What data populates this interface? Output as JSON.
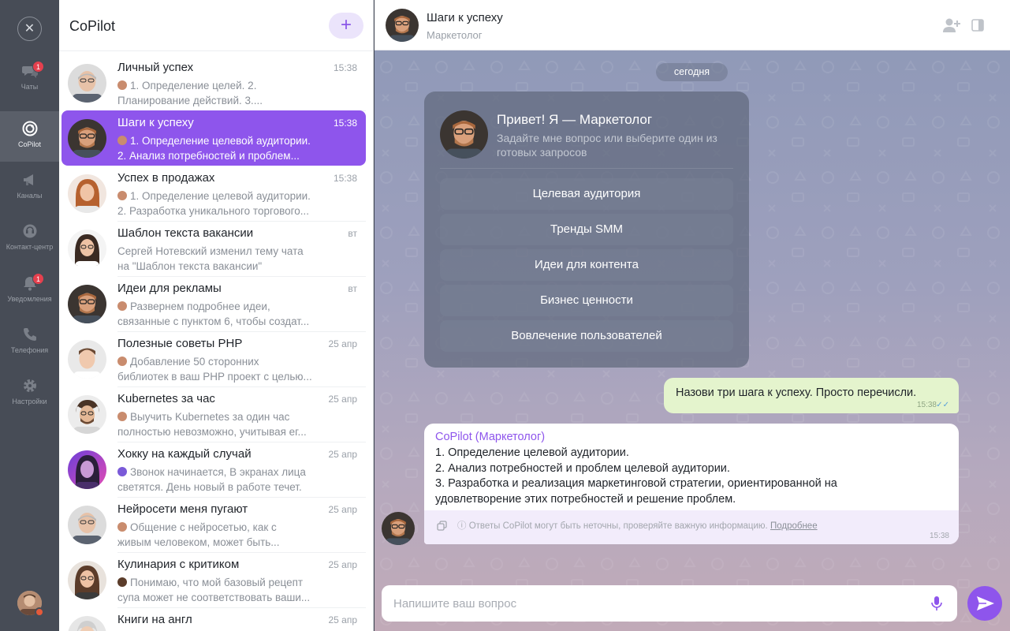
{
  "rail": {
    "items": [
      {
        "label": "Чаты",
        "icon": "chat-bubbles-icon",
        "badge": "1"
      },
      {
        "label": "CoPilot",
        "icon": "copilot-icon",
        "badge": ""
      },
      {
        "label": "Каналы",
        "icon": "megaphone-icon",
        "badge": ""
      },
      {
        "label": "Контакт-центр",
        "icon": "contact-center-icon",
        "badge": ""
      },
      {
        "label": "Уведомления",
        "icon": "bell-icon",
        "badge": "1"
      },
      {
        "label": "Телефония",
        "icon": "phone-icon",
        "badge": ""
      },
      {
        "label": "Настройки",
        "icon": "gear-icon",
        "badge": ""
      }
    ]
  },
  "list": {
    "title": "CoPilot",
    "add_label": "+",
    "chats": [
      {
        "name": "Личный успех",
        "time": "15:38",
        "line1": "1. Определение целей. 2.",
        "line2": "Планирование действий. 3....",
        "mini": true
      },
      {
        "name": "Шаги к успеху",
        "time": "15:38",
        "line1": "1. Определение целевой аудитории.",
        "line2": "2. Анализ потребностей и проблем...",
        "mini": true
      },
      {
        "name": "Успех в продажах",
        "time": "15:38",
        "line1": "1. Определение целевой аудитории.",
        "line2": "2. Разработка уникального торгового...",
        "mini": true
      },
      {
        "name": "Шаблон текста вакансии",
        "time": "вт",
        "line1": "Сергей Нотевский изменил тему чата",
        "line2": "на \"Шаблон текста вакансии\"",
        "mini": false
      },
      {
        "name": "Идеи для рекламы",
        "time": "вт",
        "line1": "Развернем подробнее идеи,",
        "line2": "связанные с пунктом 6, чтобы создат...",
        "mini": true
      },
      {
        "name": "Полезные советы PHP",
        "time": "25 апр",
        "line1": "Добавление 50 сторонних",
        "line2": "библиотек в ваш PHP проект с целью...",
        "mini": true
      },
      {
        "name": "Kubernetes за час",
        "time": "25 апр",
        "line1": "Выучить Kubernetes за один час",
        "line2": "полностью невозможно, учитывая ег...",
        "mini": true
      },
      {
        "name": "Хокку на каждый случай",
        "time": "25 апр",
        "line1": "Звонок начинается, В экранах лица",
        "line2": "светятся. День новый в работе течет.",
        "mini": true
      },
      {
        "name": "Нейросети меня пугают",
        "time": "25 апр",
        "line1": "Общение с нейросетью, как с",
        "line2": "живым человеком, может быть...",
        "mini": true
      },
      {
        "name": "Кулинария с критиком",
        "time": "25 апр",
        "line1": "Понимаю, что мой базовый рецепт",
        "line2": "супа может не соответствовать ваши...",
        "mini": true
      },
      {
        "name": "Книги на англ",
        "time": "25 апр",
        "line1": "",
        "line2": "",
        "mini": false
      }
    ]
  },
  "header": {
    "title": "Шаги к успеху",
    "subtitle": "Маркетолог"
  },
  "conversation": {
    "date": "сегодня",
    "welcome_title": "Привет! Я — Маркетолог",
    "welcome_sub": "Задайте мне вопрос или выберите один из готовых запросов",
    "suggestions": [
      "Целевая аудитория",
      "Тренды SMM",
      "Идеи для контента",
      "Бизнес ценности",
      "Вовлечение пользователей"
    ],
    "outgoing": {
      "text": "Назови три шага к успеху. Просто перечисли.",
      "time": "15:38",
      "checks": "✓✓"
    },
    "incoming": {
      "author": "CoPilot (Маркетолог)",
      "line1": "1. Определение целевой аудитории.",
      "line2": "2. Анализ потребностей и проблем целевой аудитории.",
      "line3": "3. Разработка и реализация маркетинговой стратегии, ориентированной на удовлетворение этих потребностей и решение проблем.",
      "note": "ⓘ Ответы CoPilot могут быть неточны, проверяйте важную информацию.",
      "note_link": "Подробнее",
      "time": "15:38"
    }
  },
  "composer": {
    "placeholder": "Напишите ваш вопрос"
  },
  "colors": {
    "accent": "#8e55ec",
    "outgoing_bubble": "#e4f4cd",
    "rail_bg": "#474c56",
    "badge": "#e5404e"
  }
}
